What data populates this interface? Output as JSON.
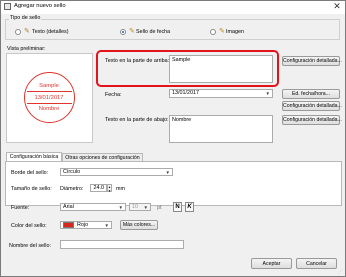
{
  "window": {
    "title": "Agregar nuevo sello",
    "close_glyph": "✕"
  },
  "stamp_type": {
    "label": "Tipo de sello",
    "options": [
      {
        "label": "Texto (detalles)",
        "icon": "text-stamp-icon",
        "selected": false
      },
      {
        "label": "Sello de fecha",
        "icon": "date-stamp-icon",
        "selected": true
      },
      {
        "label": "Imagen",
        "icon": "image-stamp-icon",
        "selected": false
      }
    ]
  },
  "preview": {
    "label": "Vista preliminar:",
    "stamp": {
      "top": "Sample",
      "date": "13/01/2017",
      "bottom": "Nombre",
      "color": "#e0342c"
    }
  },
  "fields": {
    "top_text_label": "Texto en la parte de arriba:",
    "top_text_value": "Sample",
    "top_config_button": "Configuración detallada...",
    "date_label": "Fecha:",
    "date_value": "13/01/2017",
    "date_button": "Ed. fecha/hora...",
    "date_config_button": "Configuración detallada...",
    "bottom_text_label": "Texto en la parte de abajo:",
    "bottom_text_value": "Nombre",
    "bottom_config_button": "Configuración detallada..."
  },
  "tabs": [
    {
      "label": "Configuración básica",
      "active": true
    },
    {
      "label": "Otras opciones de configuración",
      "active": false
    }
  ],
  "basic": {
    "border_label": "Borde del sello:",
    "border_value": "Círculo",
    "size_label": "Tamaño de sello:",
    "diameter_label": "Diámetro:",
    "diameter_value": "24.0",
    "diameter_unit": "mm",
    "font_label": "Fuente:",
    "font_value": "Arial",
    "font_size_value": "10",
    "font_size_unit": "pt",
    "bold_glyph": "N",
    "italic_glyph": "K",
    "color_label": "Color del sello:",
    "color_value": "Rojo",
    "color_hex": "#d9261c",
    "more_colors_button": "Más colores..."
  },
  "name": {
    "label": "Nombre del sello:",
    "value": ""
  },
  "buttons": {
    "ok": "Aceptar",
    "cancel": "Cancelar"
  },
  "accent": {
    "highlight": "#e3131b",
    "selection": "#1a5fb4"
  }
}
